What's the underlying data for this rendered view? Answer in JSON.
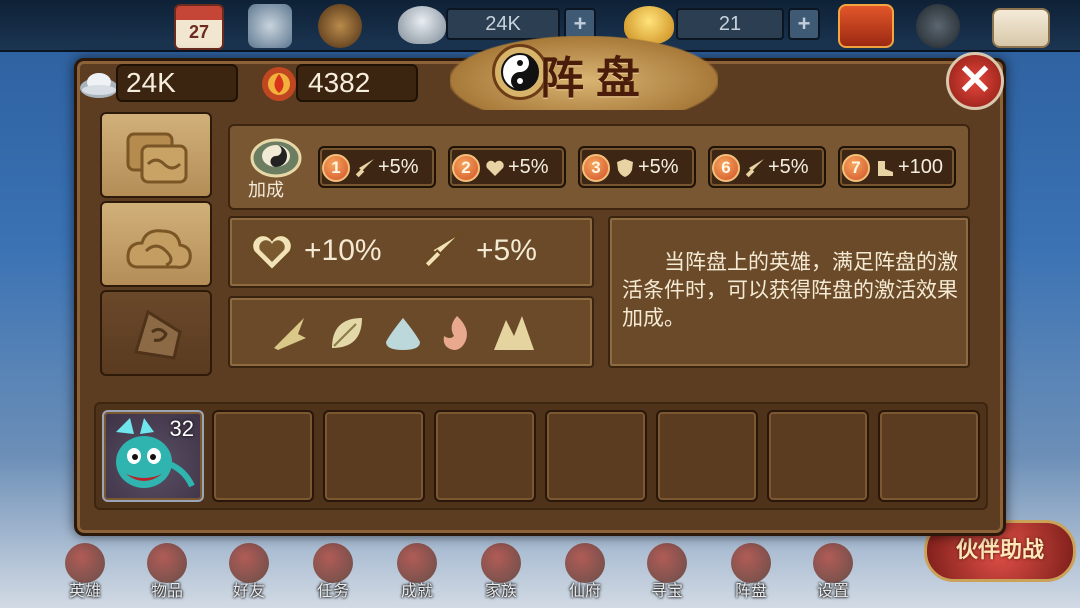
{
  "top_bar": {
    "calendar_day": "27",
    "silver": "24K",
    "gold": "21",
    "plus_symbol": "+"
  },
  "panel": {
    "title": "阵盘",
    "close_symbol": "✕",
    "silver": "24K",
    "fire_currency": "4382",
    "tabs": [
      {
        "name": "scrolls",
        "active": true
      },
      {
        "name": "cloud",
        "active": true
      },
      {
        "name": "stone",
        "active": false
      }
    ],
    "bonus": {
      "label": "加成",
      "chips": [
        {
          "num": "1",
          "icon": "sword-icon",
          "value": "+5%"
        },
        {
          "num": "2",
          "icon": "heart-icon",
          "value": "+5%"
        },
        {
          "num": "3",
          "icon": "shield-icon",
          "value": "+5%"
        },
        {
          "num": "6",
          "icon": "sword-icon",
          "value": "+5%"
        },
        {
          "num": "7",
          "icon": "boot-icon",
          "value": "+100"
        }
      ]
    },
    "stats": {
      "hp": "+10%",
      "attack": "+5%"
    },
    "elements": [
      "metal-icon",
      "wood-icon",
      "water-icon",
      "fire-icon",
      "earth-icon"
    ],
    "description": "当阵盘上的英雄，满足阵盘的激活条件时，可以获得阵盘的激活效果加成。",
    "hero_slot": {
      "level": "32"
    }
  },
  "bottom_nav": [
    {
      "label": "英雄"
    },
    {
      "label": "物品"
    },
    {
      "label": "好友"
    },
    {
      "label": "任务"
    },
    {
      "label": "成就"
    },
    {
      "label": "家族"
    },
    {
      "label": "仙府"
    },
    {
      "label": "寻宝"
    },
    {
      "label": "阵盘"
    },
    {
      "label": "设置"
    }
  ],
  "help_battle": "伙伴助战",
  "colors": {
    "panel_bg": "#5d3d22",
    "chip_number": "#e0652e",
    "text_light": "#f4ead4",
    "close_red": "#e5473c"
  }
}
